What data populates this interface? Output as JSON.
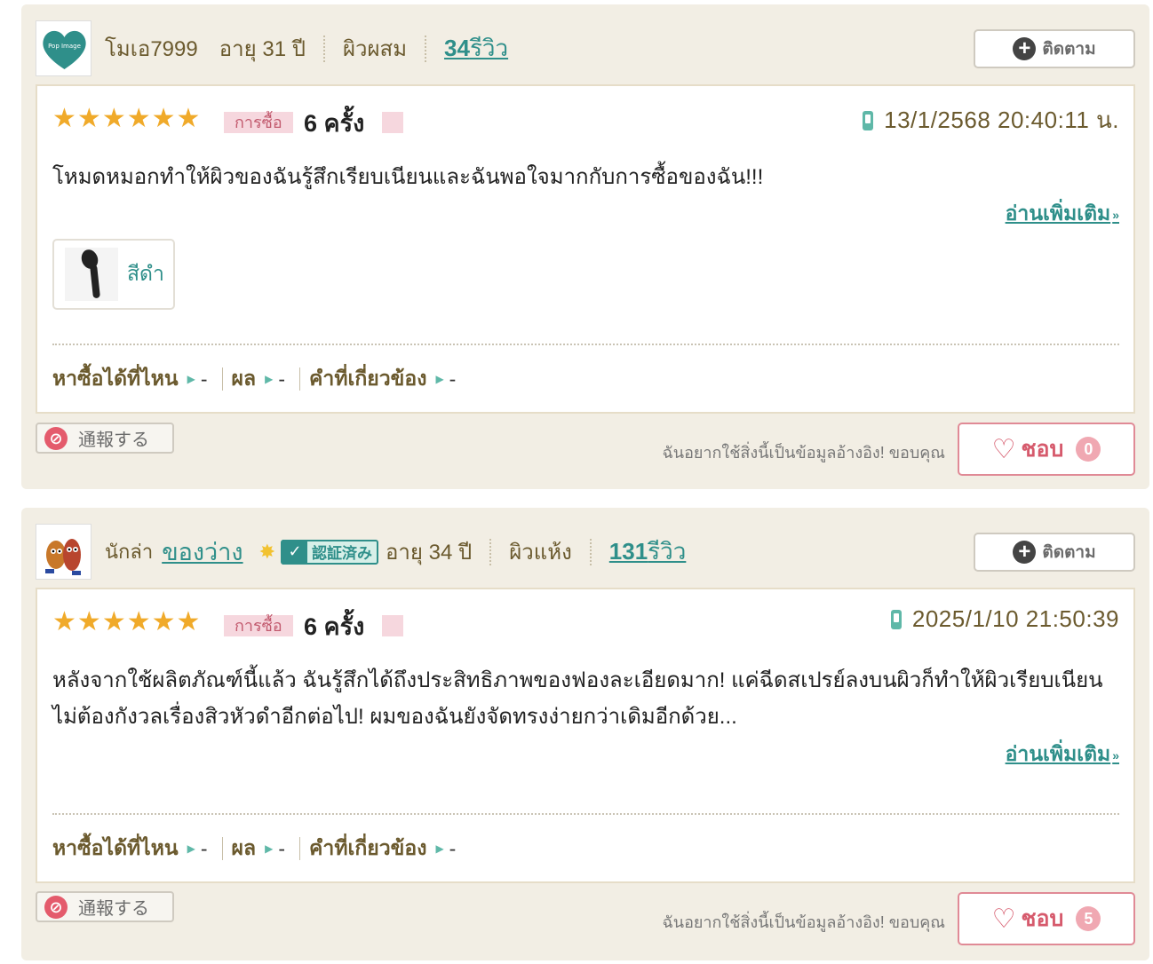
{
  "reviews": [
    {
      "nickname": "โมเอ7999",
      "age": "อายุ 31 ปี",
      "skin": "ผิวผสม",
      "review_count": "34",
      "review_unit": "รีวิว",
      "follow_label": "ติดตาม",
      "buy_tag": "การซื้อ",
      "buy_count": "6 ครั้ง",
      "date": "13/1/2568 20:40:11 น.",
      "text": "โหมดหมอกทำให้ผิวของฉันรู้สึกเรียบเนียนและฉันพอใจมากกับการซื้อของฉัน!!!",
      "read_more": "อ่านเพิ่มเติม",
      "variant": "สีดำ",
      "meta": {
        "where": "หาซื้อได้ที่ไหน",
        "where_val": "-",
        "effect": "ผล",
        "effect_val": "-",
        "related": "คำที่เกี่ยวข้อง",
        "related_val": "-"
      },
      "report_label": "通報する",
      "thanks": "ฉันอยากใช้สิ่งนี้เป็นข้อมูลอ้างอิง! ขอบคุณ",
      "like_label": "ชอบ",
      "like_count": "0"
    },
    {
      "nick_prefix": "นักล่า",
      "nickname": "ของว่าง",
      "verified": "認証済み",
      "age": "อายุ 34 ปี",
      "skin": "ผิวแห้ง",
      "review_count": "131",
      "review_unit": "รีวิว",
      "follow_label": "ติดตาม",
      "buy_tag": "การซื้อ",
      "buy_count": "6 ครั้ง",
      "date": "2025/1/10 21:50:39",
      "text": "หลังจากใช้ผลิตภัณฑ์นี้แล้ว ฉันรู้สึกได้ถึงประสิทธิภาพของฟองละเอียดมาก! แค่ฉีดสเปรย์ลงบนผิวก็ทำให้ผิวเรียบเนียน ไม่ต้องกังวลเรื่องสิวหัวดำอีกต่อไป! ผมของฉันยังจัดทรงง่ายกว่าเดิมอีกด้วย...",
      "read_more": "อ่านเพิ่มเติม",
      "meta": {
        "where": "หาซื้อได้ที่ไหน",
        "where_val": "-",
        "effect": "ผล",
        "effect_val": "-",
        "related": "คำที่เกี่ยวข้อง",
        "related_val": "-"
      },
      "report_label": "通報する",
      "thanks": "ฉันอยากใช้สิ่งนี้เป็นข้อมูลอ้างอิง! ขอบคุณ",
      "like_label": "ชอบ",
      "like_count": "5"
    }
  ],
  "avatar1_text": "Pop Image",
  "rating": 6
}
